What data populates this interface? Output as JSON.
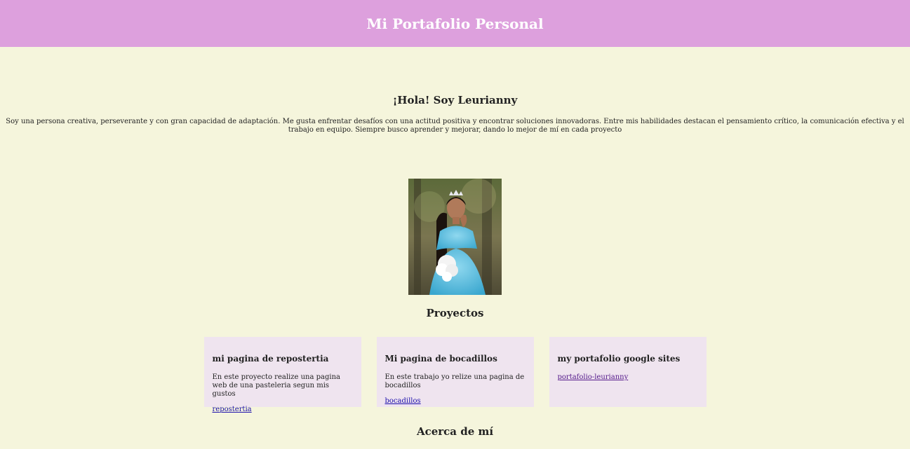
{
  "header": {
    "title": "Mi Portafolio Personal"
  },
  "intro": {
    "greeting": "¡Hola! Soy Leurianny",
    "bio": "Soy una persona creativa, perseverante y con gran capacidad de adaptación. Me gusta enfrentar desafíos con una actitud positiva y encontrar soluciones innovadoras. Entre mis habilidades destacan el pensamiento crítico, la comunicación efectiva y el trabajo en equipo. Siempre busco aprender y mejorar, dando lo mejor de mí en cada proyecto"
  },
  "projects": {
    "title": "Proyectos",
    "items": [
      {
        "title": "mi pagina de repostertia",
        "description": "En este proyecto realize una pagina web de una pasteleria segun mis gustos",
        "link": "repostertia"
      },
      {
        "title": "Mi pagina de bocadillos",
        "description": "En este trabajo yo relize una pagina de bocadillos",
        "link": "bocadillos"
      },
      {
        "title": "my portafolio google sites",
        "description": "",
        "link": "portafolio-leurianny"
      }
    ]
  },
  "about": {
    "title": "Acerca de mí"
  },
  "colors": {
    "header_bg": "#dda0dd",
    "page_bg": "#f5f5dc",
    "card_bg": "#efe4ef",
    "link": "#1a0dab",
    "visited_link": "#551a8b"
  }
}
